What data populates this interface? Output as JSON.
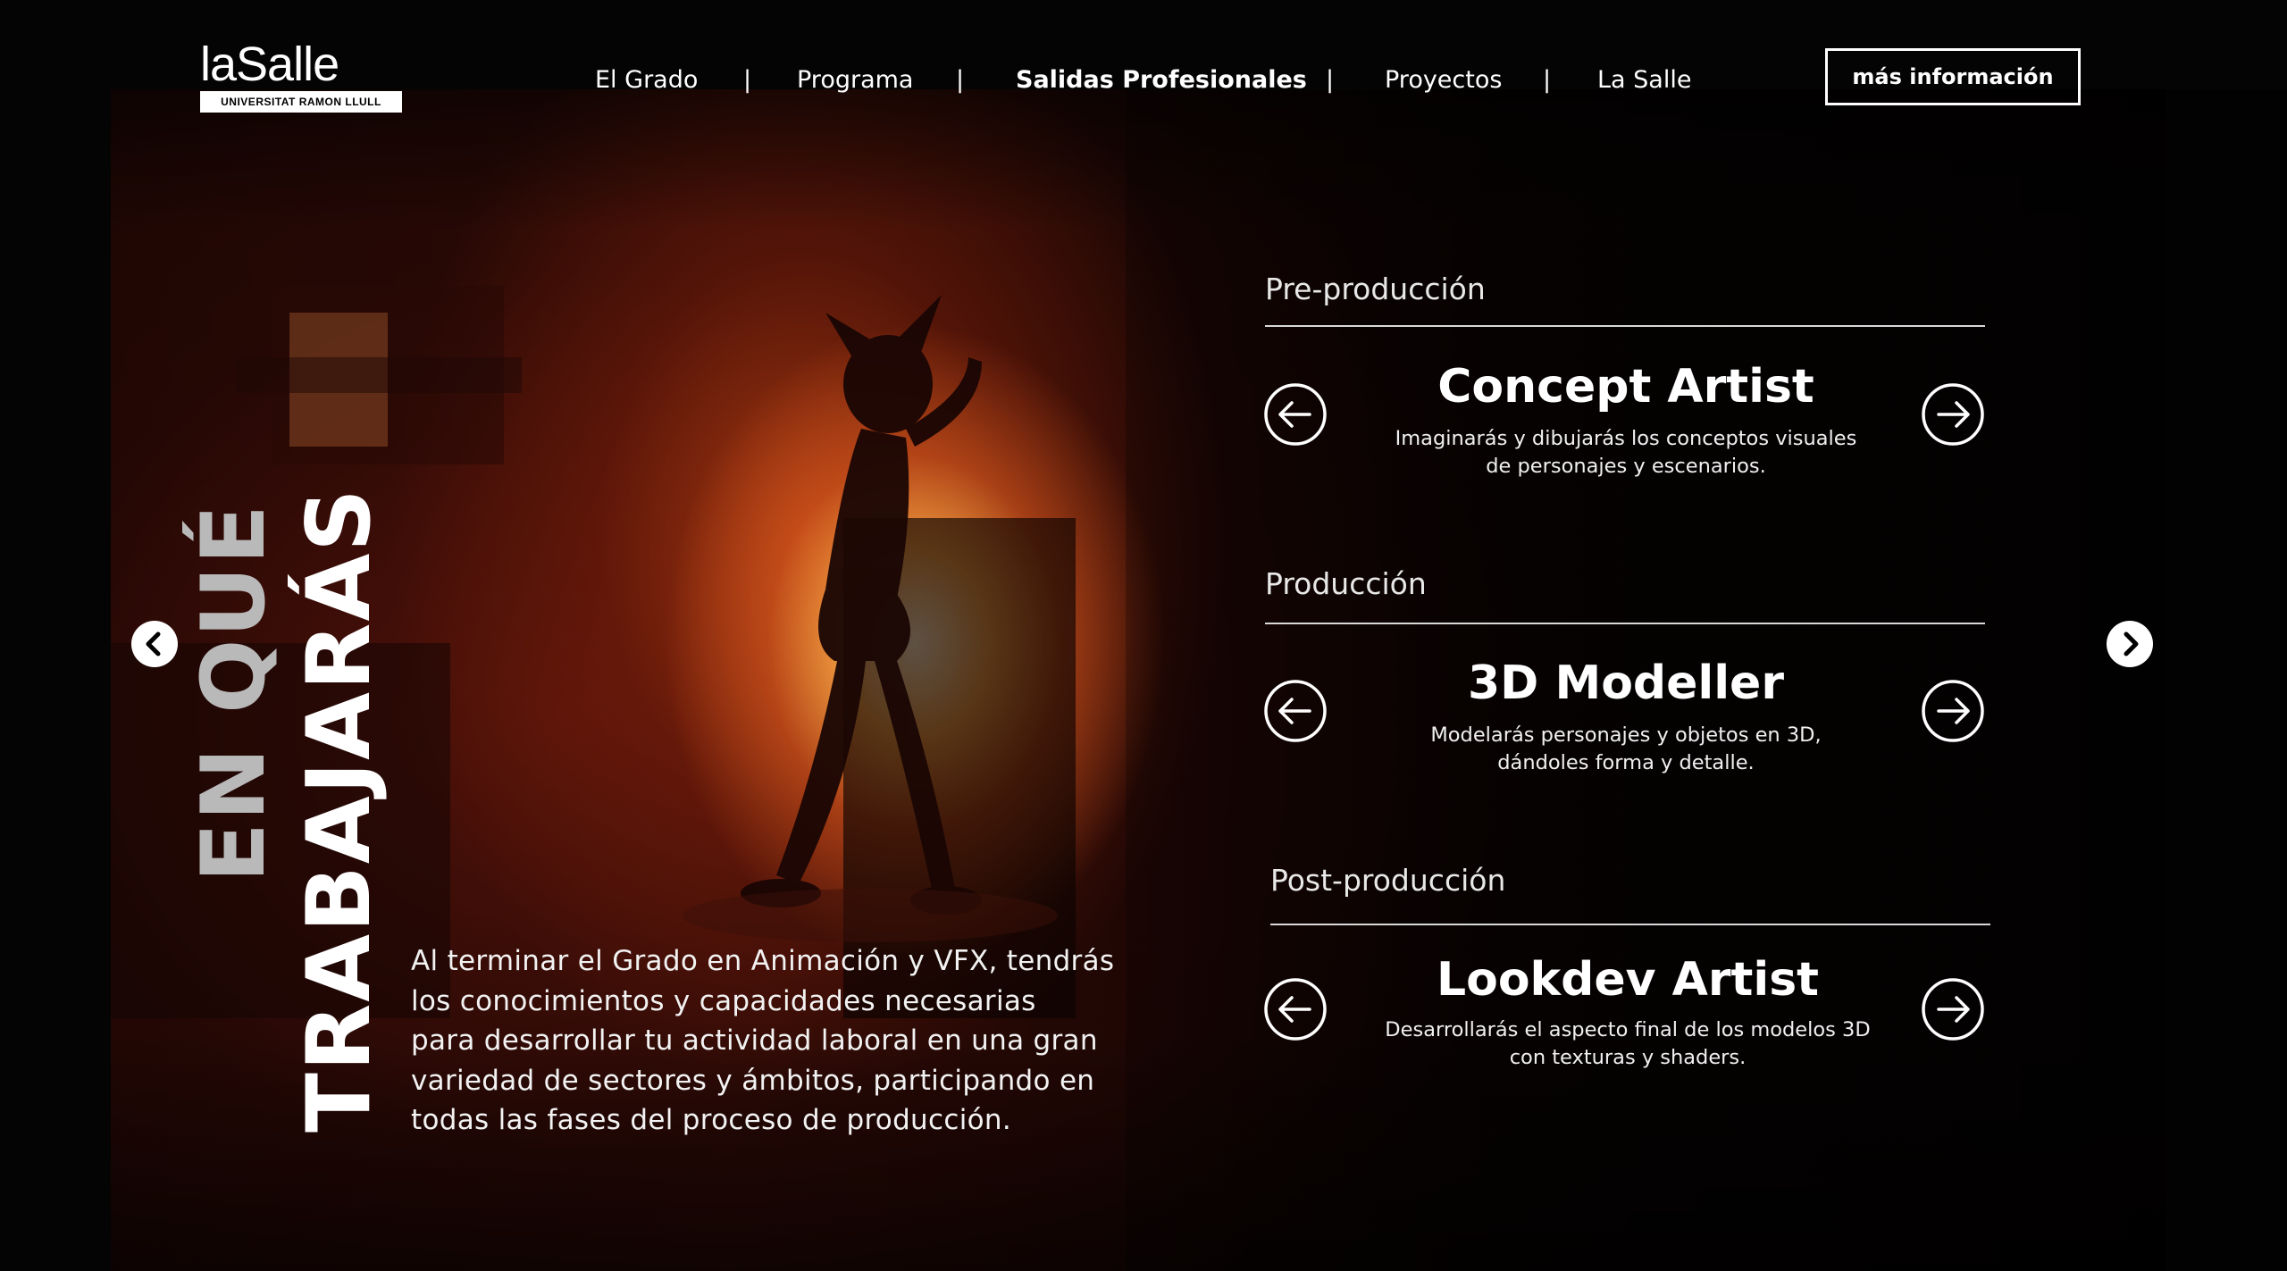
{
  "header": {
    "logo": {
      "word": "laSalle",
      "subtitle": "UNIVERSITAT RAMON LLULL"
    },
    "nav": [
      {
        "label": "El Grado",
        "active": false
      },
      {
        "label": "Programa",
        "active": false
      },
      {
        "label": "Salidas Profesionales",
        "active": true
      },
      {
        "label": "Proyectos",
        "active": false
      },
      {
        "label": "La Salle",
        "active": false
      }
    ],
    "separator": "|",
    "cta_label": "más información"
  },
  "hero": {
    "title_line1": "EN QUÉ",
    "title_line2": "TRABAJARÁS",
    "intro_lines": [
      "Al terminar el Grado en Animación y VFX, tendrás",
      "los conocimientos y capacidades necesarias",
      "para desarrollar tu actividad laboral en una gran",
      "variedad de sectores y ámbitos, participando en",
      "todas las fases del proceso de producción."
    ]
  },
  "slider": {
    "prev_icon": "chevron-left-icon",
    "next_icon": "chevron-right-icon"
  },
  "roles": [
    {
      "phase": "Pre-producción",
      "title": "Concept Artist",
      "desc_lines": [
        "Imaginarás y dibujarás los conceptos visuales",
        "de personajes y escenarios."
      ]
    },
    {
      "phase": "Producción",
      "title": "3D Modeller",
      "desc_lines": [
        "Modelarás personajes y objetos en 3D,",
        "dándoles forma y detalle."
      ]
    },
    {
      "phase": "Post-producción",
      "title": "Lookdev Artist",
      "desc_lines": [
        "Desarrollarás el aspecto final de los modelos 3D",
        "con texturas y shaders."
      ]
    }
  ],
  "colors": {
    "background": "#000000",
    "text": "#ffffff",
    "title_secondary": "#b9b9b9",
    "scene_glow": "#ff9a3c"
  }
}
